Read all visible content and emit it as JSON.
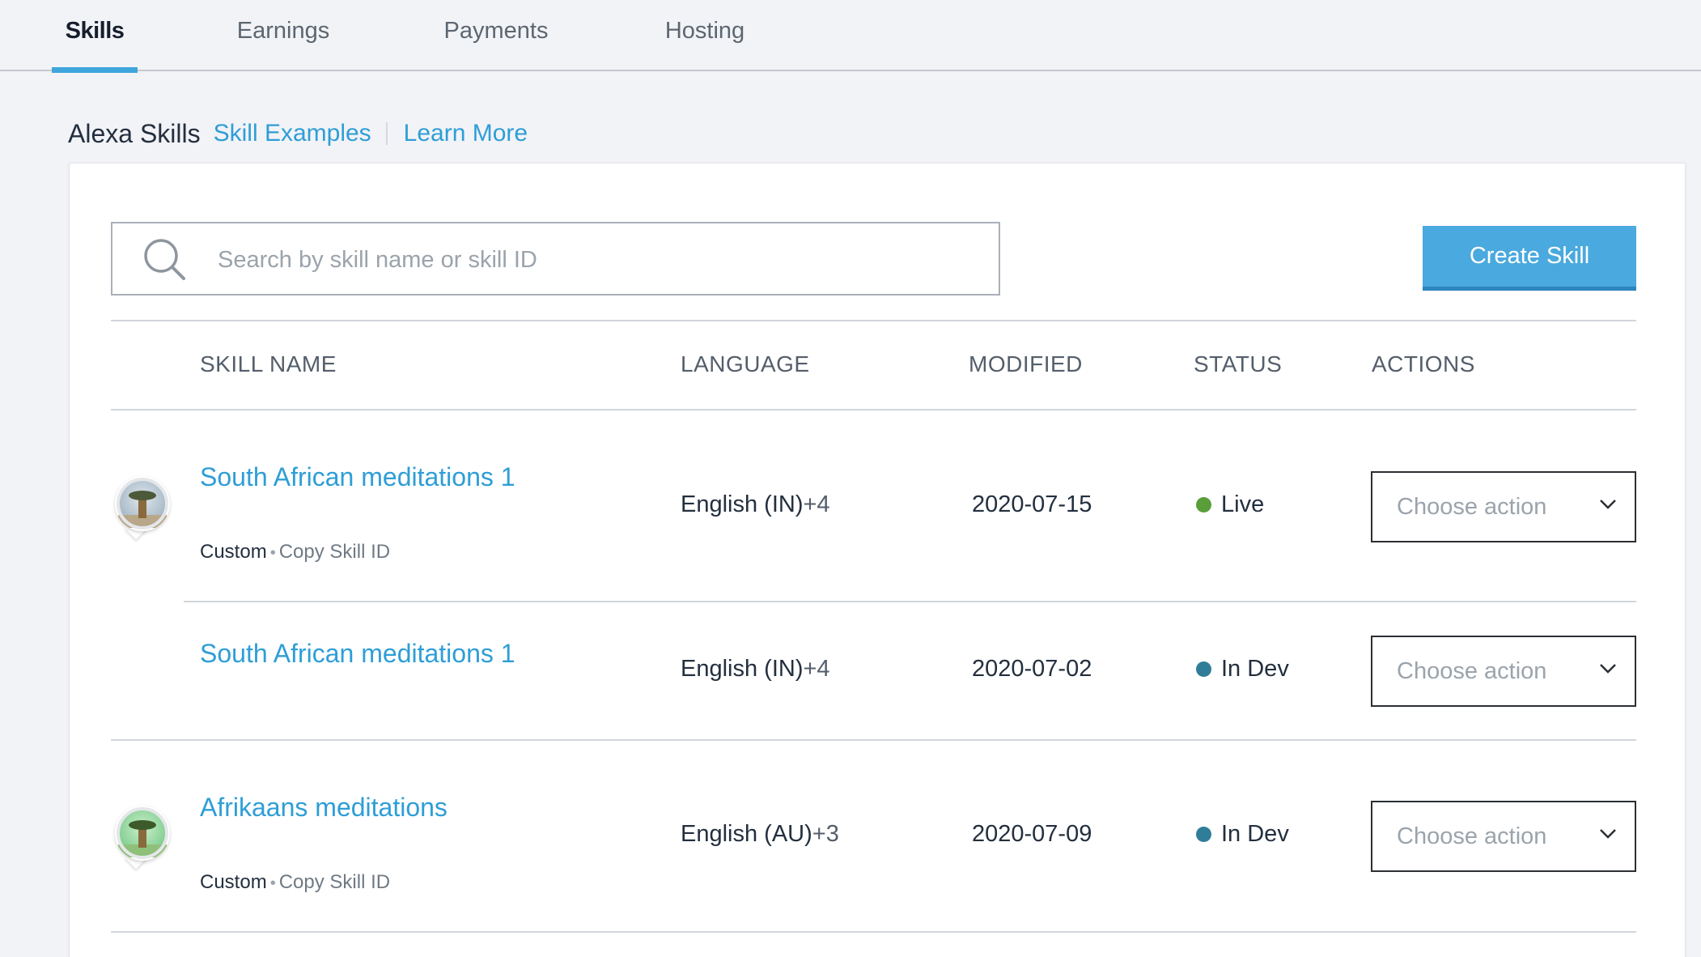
{
  "tabs": [
    {
      "label": "Skills",
      "active": true
    },
    {
      "label": "Earnings",
      "active": false
    },
    {
      "label": "Payments",
      "active": false
    },
    {
      "label": "Hosting",
      "active": false
    }
  ],
  "header": {
    "title": "Alexa Skills",
    "link_examples": "Skill Examples",
    "link_learn": "Learn More"
  },
  "search": {
    "placeholder": "Search by skill name or skill ID",
    "value": ""
  },
  "create_button": "Create Skill",
  "columns": [
    "SKILL NAME",
    "LANGUAGE",
    "MODIFIED",
    "STATUS",
    "ACTIONS"
  ],
  "rows": [
    {
      "name": "South African meditations 1",
      "type": "Custom",
      "copy_id": "Copy Skill ID",
      "language": "English (IN)",
      "language_more": "+4",
      "modified": "2020-07-15",
      "status": "Live",
      "status_color": "#5a9e3a",
      "action_placeholder": "Choose action",
      "has_avatar": true
    },
    {
      "name": "South African meditations 1",
      "language": "English (IN)",
      "language_more": "+4",
      "modified": "2020-07-02",
      "status": "In Dev",
      "status_color": "#2f7d99",
      "action_placeholder": "Choose action",
      "has_avatar": false
    },
    {
      "name": "Afrikaans meditations",
      "type": "Custom",
      "copy_id": "Copy Skill ID",
      "language": "English (AU)",
      "language_more": "+3",
      "modified": "2020-07-09",
      "status": "In Dev",
      "status_color": "#2f7d99",
      "action_placeholder": "Choose action",
      "has_avatar": true
    }
  ],
  "colors": {
    "accent": "#3ea5dd",
    "link": "#2e9ed6",
    "button": "#4aa9de"
  },
  "icons": [
    "search-icon",
    "chevron-down-icon",
    "baobab-tree-icon"
  ]
}
